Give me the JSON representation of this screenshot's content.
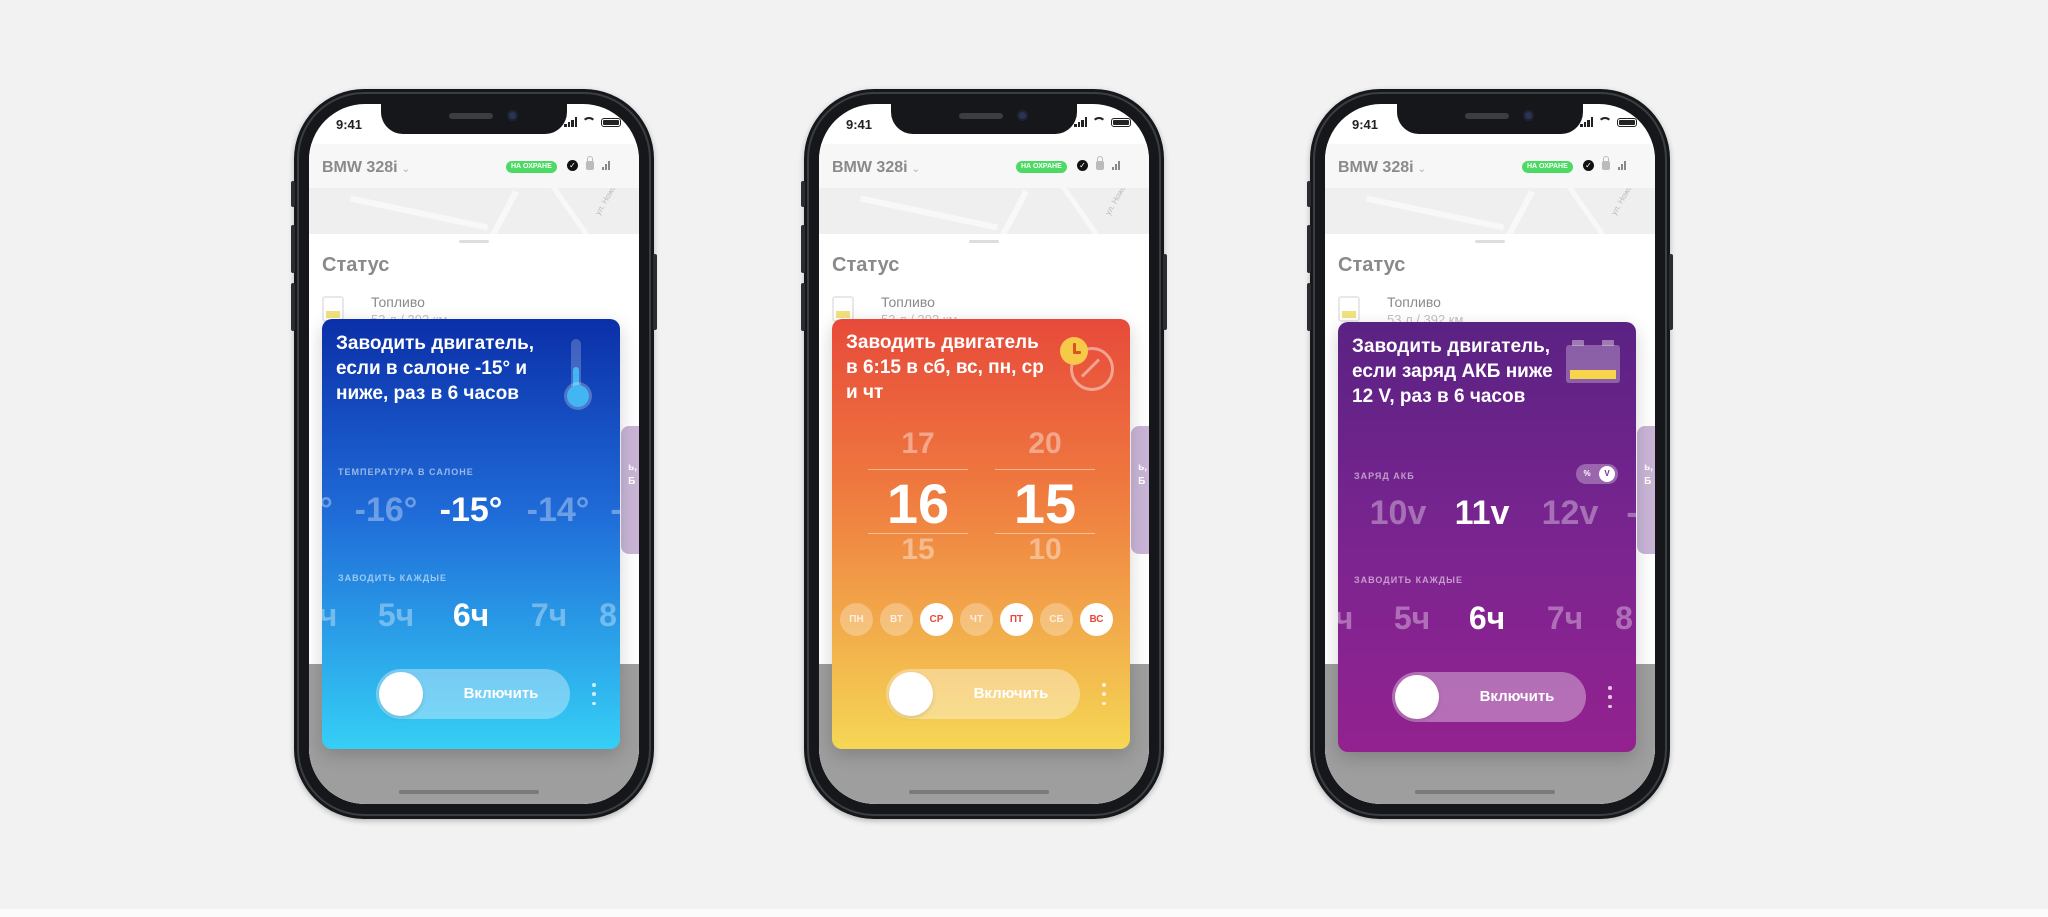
{
  "common": {
    "time": "9:41",
    "car_name": "BMW 328i",
    "guard_badge": "НА ОХРАНЕ",
    "map_street": "ул. Ножова",
    "status_title": "Статус",
    "fuel_label": "Топливо",
    "fuel_value": "53 л / 392 км",
    "peek_text": "ь,\nБ",
    "toggle_label": "Включить"
  },
  "colors": {
    "guard_badge": "#4cd964",
    "card1_top": "#0b2fa8",
    "card1_bottom": "#35cff6",
    "card2_top": "#e74a3a",
    "card2_bottom": "#f5d755",
    "card3_top": "#5a2283",
    "card3_bottom": "#93228f"
  },
  "icons": {
    "card1": "thermometer-icon",
    "card2": "clock-timer-icon",
    "card3": "car-battery-icon"
  },
  "card1": {
    "title": "Заводить двигатель, если в салоне -15° и ниже, раз в 6 часов",
    "temp_label": "ТЕМПЕРАТУРА В САЛОНЕ",
    "temps": [
      "°",
      "-16°",
      "-15°",
      "-14°",
      "-"
    ],
    "interval_label": "ЗАВОДИТЬ КАЖДЫЕ",
    "intervals": [
      "ч",
      "5ч",
      "6ч",
      "7ч",
      "8"
    ]
  },
  "card2": {
    "title": "Заводить двигатель в 6:15 в сб, вс, пн, ср и чт",
    "hours": [
      "17",
      "16",
      "15"
    ],
    "minutes": [
      "20",
      "15",
      "10"
    ],
    "days": [
      {
        "label": "ПН",
        "on": false
      },
      {
        "label": "ВТ",
        "on": false
      },
      {
        "label": "СР",
        "on": true
      },
      {
        "label": "ЧТ",
        "on": false
      },
      {
        "label": "ПТ",
        "on": true
      },
      {
        "label": "СБ",
        "on": false
      },
      {
        "label": "ВС",
        "on": true
      }
    ]
  },
  "card3": {
    "title": "Заводить двигатель, если заряд АКБ ниже 12 V, раз в 6 часов",
    "charge_label": "ЗАРЯД АКБ",
    "unit_pct": "%",
    "unit_v": "V",
    "volts": [
      "10v",
      "11v",
      "12v",
      "-"
    ],
    "interval_label": "ЗАВОДИТЬ КАЖДЫЕ",
    "intervals": [
      "ч",
      "5ч",
      "6ч",
      "7ч",
      "8"
    ]
  }
}
